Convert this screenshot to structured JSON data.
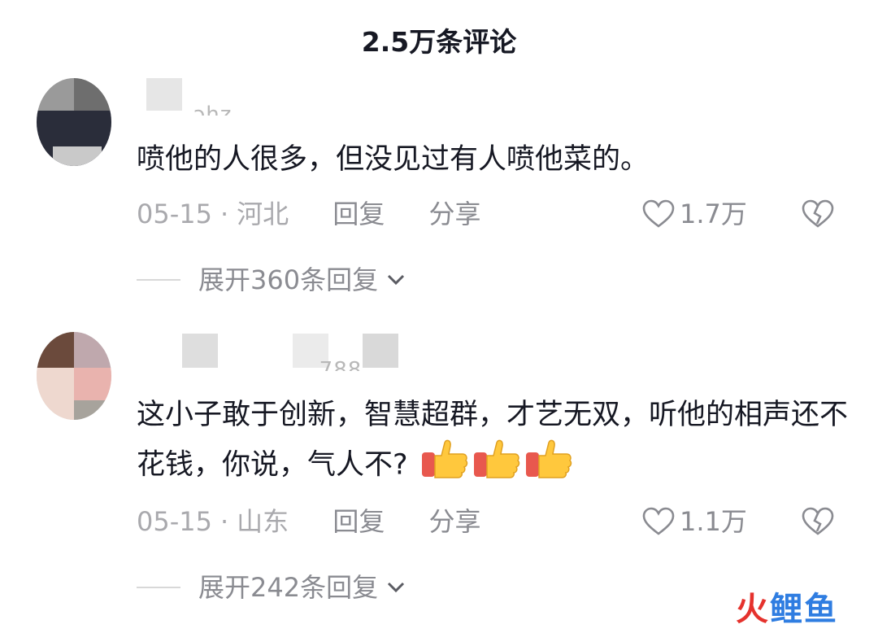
{
  "header": {
    "title": "2.5万条评论"
  },
  "comments": [
    {
      "username_partial": "ɔhz",
      "text": "喷他的人很多，但没见过有人喷他菜的。",
      "date": "05-15",
      "location": "河北",
      "reply_label": "回复",
      "share_label": "分享",
      "likes": "1.7万",
      "expand_label": "展开360条回复"
    },
    {
      "username_partial": "..... .. .788",
      "text": "这小子敢于创新，智慧超群，才艺无双，听他的相声还不花钱，你说，气人不?",
      "emojis": [
        "thumbs-up",
        "thumbs-up",
        "thumbs-up"
      ],
      "date": "05-15",
      "location": "山东",
      "reply_label": "回复",
      "share_label": "分享",
      "likes": "1.1万",
      "expand_label": "展开242条回复"
    }
  ],
  "watermark": {
    "text": "火鲤鱼",
    "colors": [
      "#e5322d",
      "#2f7de1"
    ]
  }
}
